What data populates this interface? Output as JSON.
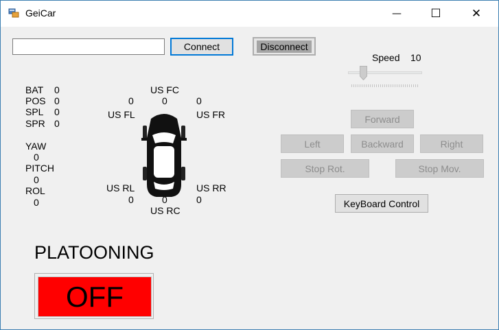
{
  "window": {
    "title": "GeiCar"
  },
  "controls": {
    "minimize": "—",
    "maximize": "☐",
    "close": "✕"
  },
  "connection": {
    "address_value": "",
    "connect_label": "Connect",
    "disconnect_label": "Disconnect"
  },
  "speed": {
    "label": "Speed",
    "value": "10",
    "slider_fraction": 0.15
  },
  "telemetry": {
    "bat_label": "BAT",
    "bat_value": "0",
    "pos_label": "POS",
    "pos_value": "0",
    "spl_label": "SPL",
    "spl_value": "0",
    "spr_label": "SPR",
    "spr_value": "0",
    "yaw_label": "YAW",
    "yaw_value": "0",
    "pitch_label": "PITCH",
    "pitch_value": "0",
    "rol_label": "ROL",
    "rol_value": "0"
  },
  "ultrasound": {
    "fc_label": "US FC",
    "fc_value": "0",
    "fl_label": "US FL",
    "fl_value": "0",
    "fr_label": "US FR",
    "fr_value": "0",
    "rl_label": "US RL",
    "rl_value": "0",
    "rr_label": "US RR",
    "rr_value": "0",
    "rc_label": "US RC",
    "rc_value": "0"
  },
  "drive": {
    "forward": "Forward",
    "left": "Left",
    "backward": "Backward",
    "right": "Right",
    "stop_rot": "Stop Rot.",
    "stop_mov": "Stop Mov.",
    "keyboard": "KeyBoard Control"
  },
  "platooning": {
    "title": "PLATOONING",
    "status": "OFF",
    "status_color": "#ff0000"
  }
}
